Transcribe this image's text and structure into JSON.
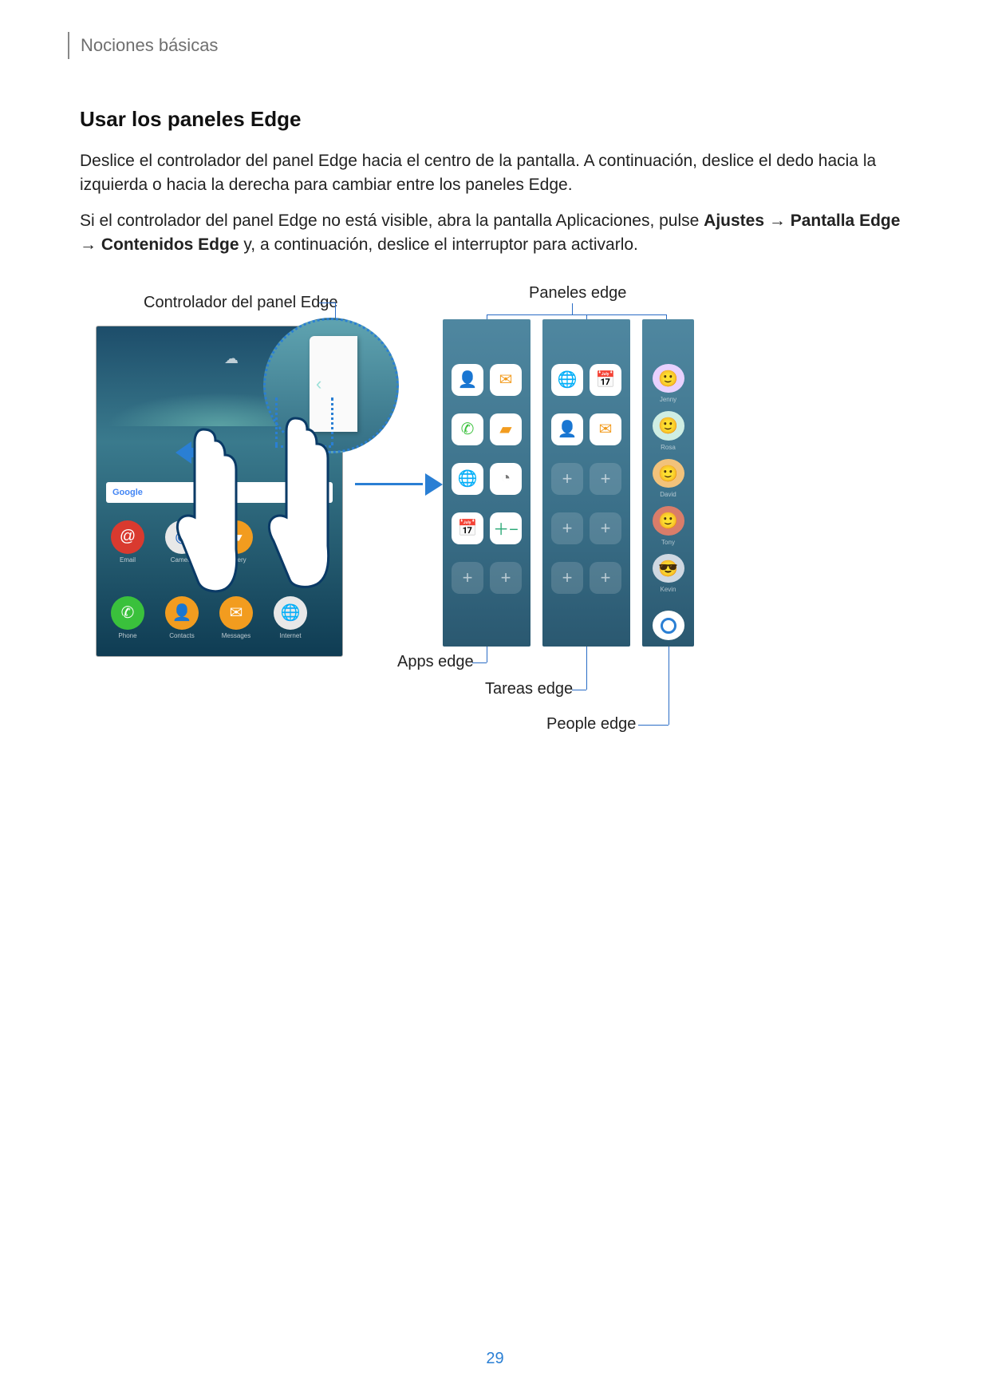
{
  "header": {
    "breadcrumb": "Nociones básicas"
  },
  "section": {
    "title": "Usar los paneles Edge"
  },
  "paragraphs": {
    "p1": "Deslice el controlador del panel Edge hacia el centro de la pantalla. A continuación, deslice el dedo hacia la izquierda o hacia la derecha para cambiar entre los paneles Edge.",
    "p2_pre": "Si el controlador del panel Edge no está visible, abra la pantalla Aplicaciones, pulse ",
    "p2_b1": "Ajustes",
    "p2_arrow1": " → ",
    "p2_b2": "Pantalla Edge",
    "p2_arrow2": " → ",
    "p2_b3": "Contenidos Edge",
    "p2_post": " y, a continuación, deslice el interruptor para activarlo."
  },
  "annotations": {
    "controller": "Controlador del panel Edge",
    "panels": "Paneles edge",
    "apps": "Apps edge",
    "tasks": "Tareas edge",
    "people": "People edge"
  },
  "phone": {
    "search_brand": "Google",
    "widget": "☁",
    "apps_row1": [
      {
        "glyph": "@",
        "cls": "ic-email",
        "label": "Email"
      },
      {
        "glyph": "◉",
        "cls": "ic-cam",
        "label": "Camera"
      },
      {
        "glyph": "▰",
        "cls": "ic-gal",
        "label": "Gallery"
      }
    ],
    "apps_row2": [
      {
        "glyph": "✆",
        "cls": "ic-phone",
        "label": "Phone"
      },
      {
        "glyph": "👤",
        "cls": "ic-contact",
        "label": "Contacts"
      },
      {
        "glyph": "✉",
        "cls": "ic-msg",
        "label": "Messages"
      },
      {
        "glyph": "🌐",
        "cls": "ic-net",
        "label": "Internet"
      }
    ],
    "pager": "≡  •  ◦"
  },
  "panels_data": {
    "apps_edge": [
      [
        {
          "glyph": "👤",
          "cls": "t-contact"
        },
        {
          "glyph": "✉",
          "cls": "t-msg"
        }
      ],
      [
        {
          "glyph": "✆",
          "cls": "t-phone"
        },
        {
          "glyph": "▰",
          "cls": "t-gal"
        }
      ],
      [
        {
          "glyph": "🌐",
          "cls": "t-net"
        },
        {
          "glyph": "◔",
          "cls": "t-clock"
        }
      ],
      [
        {
          "glyph": "📅",
          "cls": "t-cal"
        },
        {
          "glyph": "＋−",
          "cls": "t-calc"
        }
      ],
      [
        {
          "glyph": "+",
          "cls": "blank"
        },
        {
          "glyph": "+",
          "cls": "blank"
        }
      ]
    ],
    "tasks_edge": [
      [
        {
          "glyph": "🌐",
          "cls": "t-task1"
        },
        {
          "glyph": "📅",
          "cls": "t-task2"
        }
      ],
      [
        {
          "glyph": "👤",
          "cls": "t-contact"
        },
        {
          "glyph": "✉",
          "cls": "t-msg"
        }
      ],
      [
        {
          "glyph": "+",
          "cls": "blank"
        },
        {
          "glyph": "+",
          "cls": "blank"
        }
      ],
      [
        {
          "glyph": "+",
          "cls": "blank"
        },
        {
          "glyph": "+",
          "cls": "blank"
        }
      ],
      [
        {
          "glyph": "+",
          "cls": "blank"
        },
        {
          "glyph": "+",
          "cls": "blank"
        }
      ]
    ],
    "people_edge": [
      {
        "cls": "av1",
        "glyph": "🙂",
        "name": "Jenny"
      },
      {
        "cls": "av2",
        "glyph": "🙂",
        "name": "Rosa"
      },
      {
        "cls": "av3",
        "glyph": "🙂",
        "name": "David"
      },
      {
        "cls": "av4",
        "glyph": "🙂",
        "name": "Tony"
      },
      {
        "cls": "av5",
        "glyph": "😎",
        "name": "Kevin"
      }
    ]
  },
  "page_number": "29"
}
